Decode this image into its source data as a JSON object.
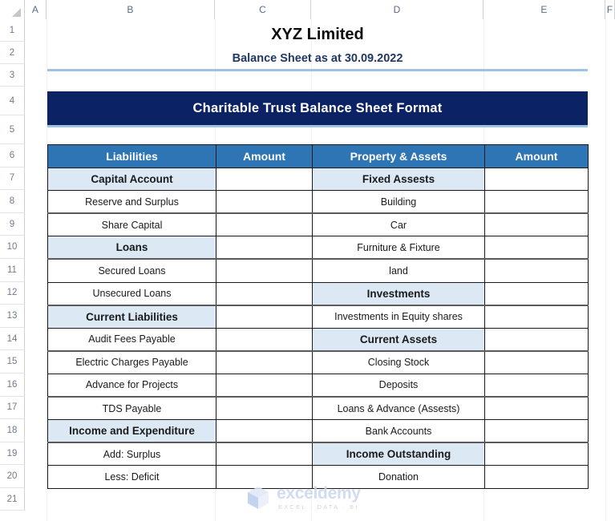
{
  "spreadsheet": {
    "column_headers": [
      "A",
      "B",
      "C",
      "D",
      "E",
      "F"
    ],
    "row_numbers": [
      "1",
      "2",
      "3",
      "4",
      "5",
      "6",
      "7",
      "8",
      "9",
      "10",
      "11",
      "12",
      "13",
      "14",
      "15",
      "16",
      "17",
      "18",
      "19",
      "20",
      "21"
    ]
  },
  "titles": {
    "company": "XYZ Limited",
    "subtitle": "Balance Sheet as at 30.09.2022",
    "banner": "Charitable Trust Balance Sheet Format"
  },
  "table": {
    "headers": [
      "Liabilities",
      "Amount",
      "Property & Assets",
      "Amount"
    ],
    "rows": [
      {
        "liability": "Capital Account",
        "liability_section": true,
        "liability_amount": "",
        "asset": "Fixed Assests",
        "asset_section": true,
        "asset_amount": ""
      },
      {
        "liability": "Reserve and Surplus",
        "liability_section": false,
        "liability_amount": "",
        "asset": "Building",
        "asset_section": false,
        "asset_amount": ""
      },
      {
        "liability": "Share Capital",
        "liability_section": false,
        "liability_amount": "",
        "asset": "Car",
        "asset_section": false,
        "asset_amount": ""
      },
      {
        "liability": "Loans",
        "liability_section": true,
        "liability_amount": "",
        "asset": "Furniture & Fixture",
        "asset_section": false,
        "asset_amount": ""
      },
      {
        "liability": "Secured Loans",
        "liability_section": false,
        "liability_amount": "",
        "asset": "land",
        "asset_section": false,
        "asset_amount": ""
      },
      {
        "liability": "Unsecured Loans",
        "liability_section": false,
        "liability_amount": "",
        "asset": "Investments",
        "asset_section": true,
        "asset_amount": ""
      },
      {
        "liability": "Current Liabilities",
        "liability_section": true,
        "liability_amount": "",
        "asset": "Investments in Equity shares",
        "asset_section": false,
        "asset_amount": ""
      },
      {
        "liability": "Audit Fees Payable",
        "liability_section": false,
        "liability_amount": "",
        "asset": "Current Assets",
        "asset_section": true,
        "asset_amount": ""
      },
      {
        "liability": "Electric Charges Payable",
        "liability_section": false,
        "liability_amount": "",
        "asset": "Closing Stock",
        "asset_section": false,
        "asset_amount": ""
      },
      {
        "liability": "Advance for Projects",
        "liability_section": false,
        "liability_amount": "",
        "asset": "Deposits",
        "asset_section": false,
        "asset_amount": ""
      },
      {
        "liability": "TDS Payable",
        "liability_section": false,
        "liability_amount": "",
        "asset": "Loans & Advance (Assests)",
        "asset_section": false,
        "asset_amount": ""
      },
      {
        "liability": "Income and Expenditure",
        "liability_section": true,
        "liability_amount": "",
        "asset": "Bank Accounts",
        "asset_section": false,
        "asset_amount": ""
      },
      {
        "liability": "Add: Surplus",
        "liability_section": false,
        "liability_amount": "",
        "asset": "Income Outstanding",
        "asset_section": true,
        "asset_amount": ""
      },
      {
        "liability": "Less: Deficit",
        "liability_section": false,
        "liability_amount": "",
        "asset": "Donation",
        "asset_section": false,
        "asset_amount": ""
      }
    ]
  },
  "watermark": {
    "name": "exceldemy",
    "tagline": "EXCEL · DATA · BI"
  },
  "colors": {
    "banner_navy": "#0B2265",
    "header_blue": "#2E75B6",
    "section_fill": "#DCE9F5",
    "rule_blue": "#9CC3E5",
    "subtitle_navy": "#1F3864"
  }
}
